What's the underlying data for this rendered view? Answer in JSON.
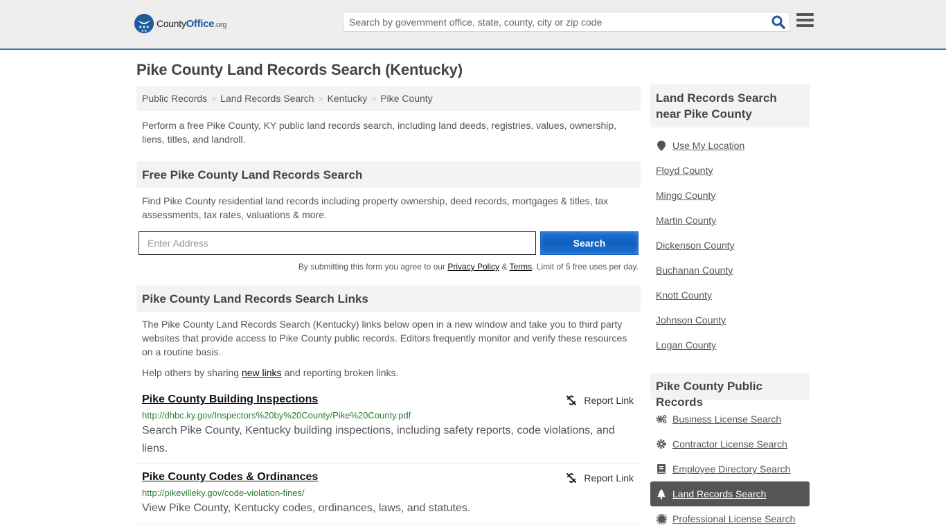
{
  "header": {
    "logo": {
      "name": "County",
      "office": "Office",
      "tld": ".org"
    },
    "search_placeholder": "Search by government office, state, county, city or zip code"
  },
  "page_title": "Pike County Land Records Search (Kentucky)",
  "breadcrumb": [
    {
      "label": "Public Records"
    },
    {
      "label": "Land Records Search"
    },
    {
      "label": "Kentucky"
    },
    {
      "label": "Pike County"
    }
  ],
  "intro": "Perform a free Pike County, KY public land records search, including land deeds, registries, values, ownership, liens, titles, and landroll.",
  "free_search": {
    "heading": "Free Pike County Land Records Search",
    "description": "Find Pike County residential land records including property ownership, deed records, mortgages & titles, tax assessments, tax rates, valuations & more.",
    "address_placeholder": "Enter Address",
    "button_label": "Search",
    "terms_prefix": "By submitting this form you agree to our ",
    "privacy_label": "Privacy Policy",
    "terms_amp": " & ",
    "terms_label": "Terms",
    "terms_suffix": ". Limit of 5 free uses per day."
  },
  "links_section": {
    "heading": "Pike County Land Records Search Links",
    "description": "The Pike County Land Records Search (Kentucky) links below open in a new window and take you to third party websites that provide access to Pike County public records. Editors frequently monitor and verify these resources on a routine basis.",
    "help_prefix": "Help others by sharing ",
    "help_link": "new links",
    "help_suffix": " and reporting broken links.",
    "report_label": "Report Link",
    "items": [
      {
        "title": "Pike County Building Inspections",
        "url": "http://dhbc.ky.gov/Inspectors%20by%20County/Pike%20County.pdf",
        "description": "Search Pike County, Kentucky building inspections, including safety reports, code violations, and liens."
      },
      {
        "title": "Pike County Codes & Ordinances",
        "url": "http://pikevilleky.gov/code-violation-fines/",
        "description": "View Pike County, Kentucky codes, ordinances, laws, and statutes."
      }
    ]
  },
  "sidebar": {
    "nearby_heading": "Land Records Search near Pike County",
    "use_location": "Use My Location",
    "nearby": [
      "Floyd County",
      "Mingo County",
      "Martin County",
      "Dickenson County",
      "Buchanan County",
      "Knott County",
      "Johnson County",
      "Logan County"
    ],
    "records_heading": "Pike County Public Records",
    "records": [
      {
        "label": "Business License Search",
        "icon": "gears-icon",
        "active": false
      },
      {
        "label": "Contractor License Search",
        "icon": "gear-icon",
        "active": false
      },
      {
        "label": "Employee Directory Search",
        "icon": "book-icon",
        "active": false
      },
      {
        "label": "Land Records Search",
        "icon": "tree-icon",
        "active": true
      },
      {
        "label": "Professional License Search",
        "icon": "certificate-icon",
        "active": false
      }
    ]
  },
  "colors": {
    "brand_blue": "#1e5c9e",
    "header_border": "#3a7bb5",
    "search_button": "#1565c0",
    "url_green": "#2e7d32",
    "active_bg": "#555555"
  }
}
